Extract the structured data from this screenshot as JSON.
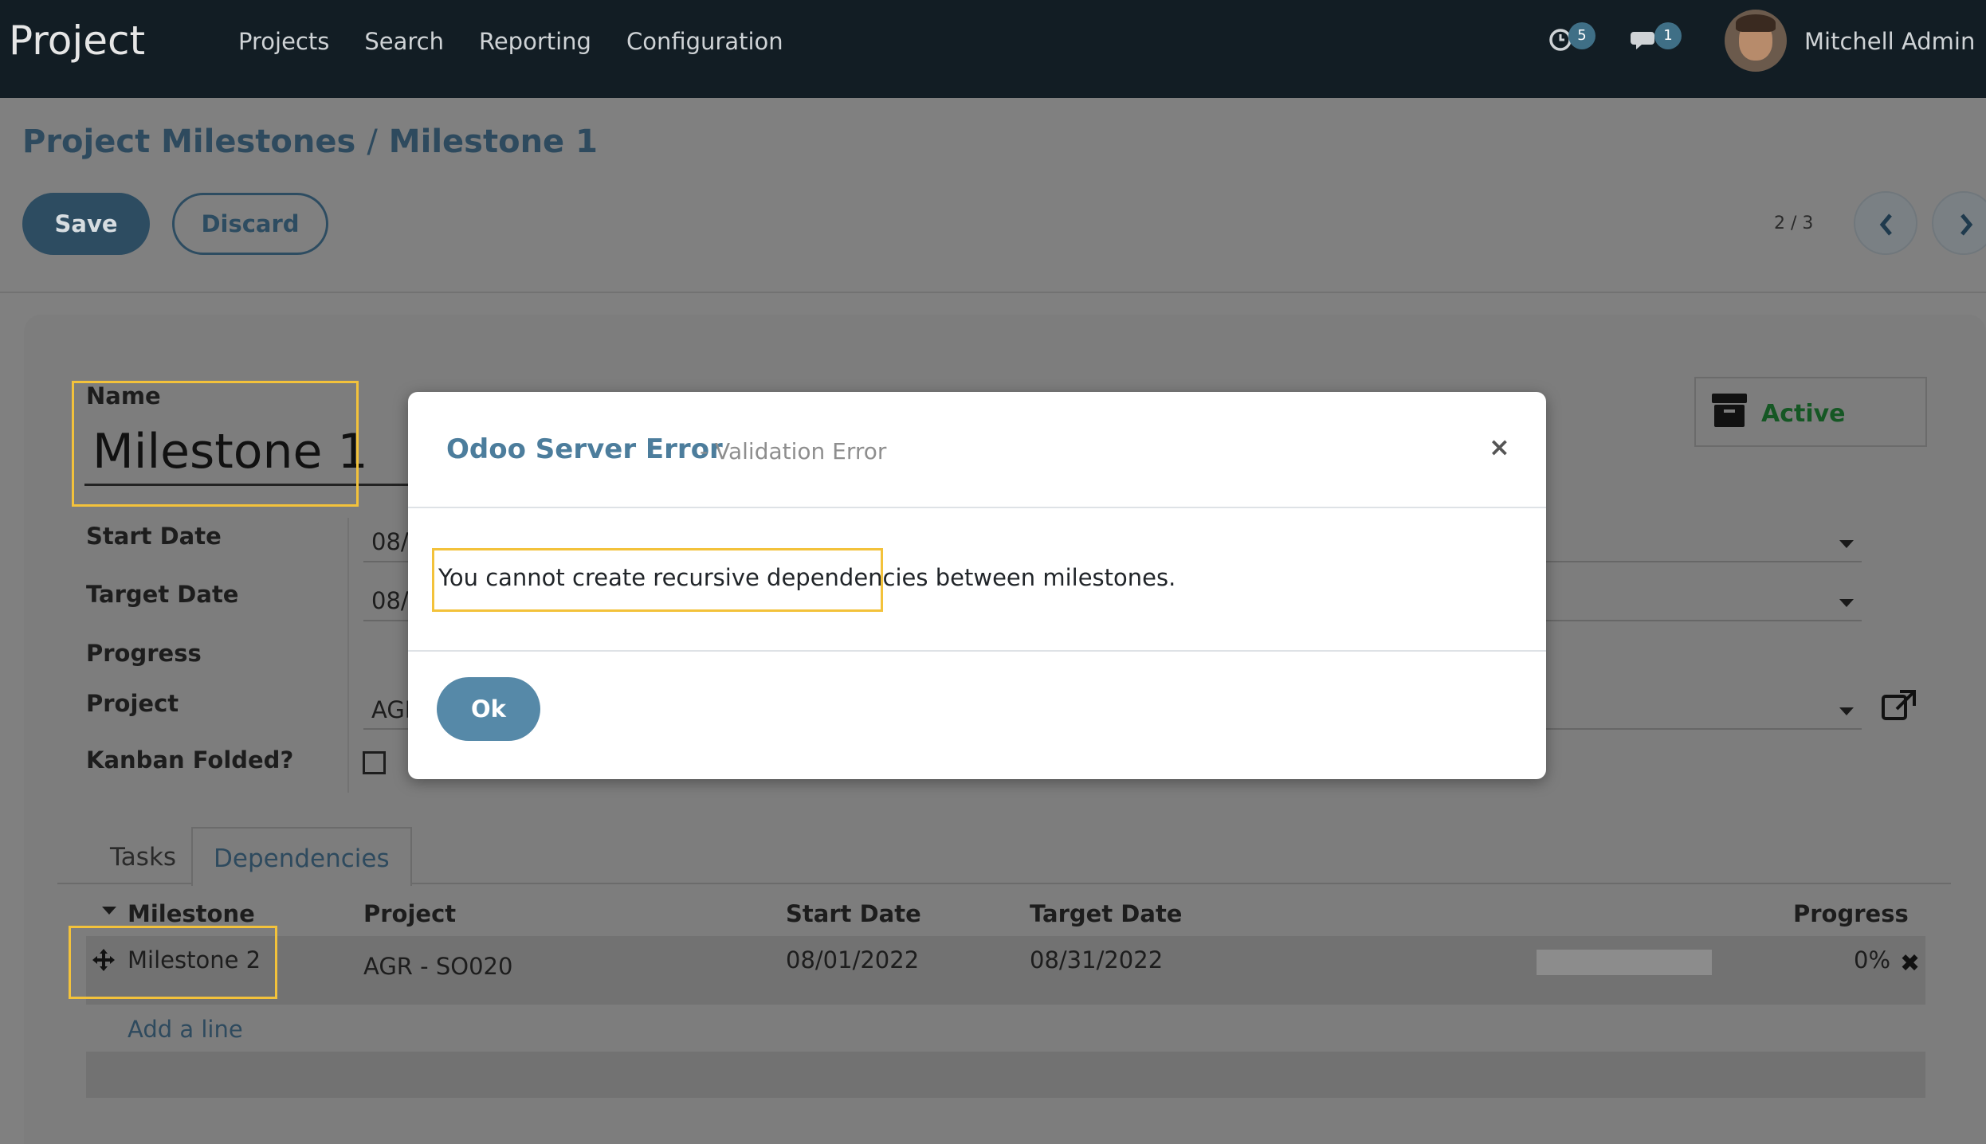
{
  "navbar": {
    "app_name": "Project",
    "menu": [
      "Projects",
      "Search",
      "Reporting",
      "Configuration"
    ],
    "activity_count": "5",
    "message_count": "1",
    "user_name": "Mitchell Admin"
  },
  "breadcrumb": {
    "parent": "Project Milestones",
    "separator": "/",
    "current": "Milestone 1"
  },
  "toolbar": {
    "save_label": "Save",
    "discard_label": "Discard",
    "pager": "2 / 3"
  },
  "form": {
    "name_label": "Name",
    "name_value": "Milestone 1",
    "status": "Active",
    "fields": {
      "start_date_label": "Start Date",
      "start_date_value": "08/",
      "target_date_label": "Target Date",
      "target_date_value": "08/",
      "progress_label": "Progress",
      "project_label": "Project",
      "project_value": "AGF",
      "kanban_folded_label": "Kanban Folded?"
    }
  },
  "tabs": [
    {
      "label": "Tasks",
      "active": false
    },
    {
      "label": "Dependencies",
      "active": true
    }
  ],
  "dependencies": {
    "columns": [
      "Milestone",
      "Project",
      "Start Date",
      "Target Date",
      "Progress"
    ],
    "rows": [
      {
        "milestone": "Milestone 2",
        "project": "AGR - SO020",
        "start_date": "08/01/2022",
        "target_date": "08/31/2022",
        "progress": "0%"
      }
    ],
    "add_line": "Add a line"
  },
  "dialog": {
    "title": "Odoo Server Error",
    "subtitle": "- Validation Error",
    "message": "You cannot create recursive dependencies between milestones.",
    "ok_label": "Ok"
  },
  "colors": {
    "navbar": "#121d24",
    "primary": "#5689a8",
    "highlight": "#f3c23b",
    "active_status": "#155724"
  }
}
